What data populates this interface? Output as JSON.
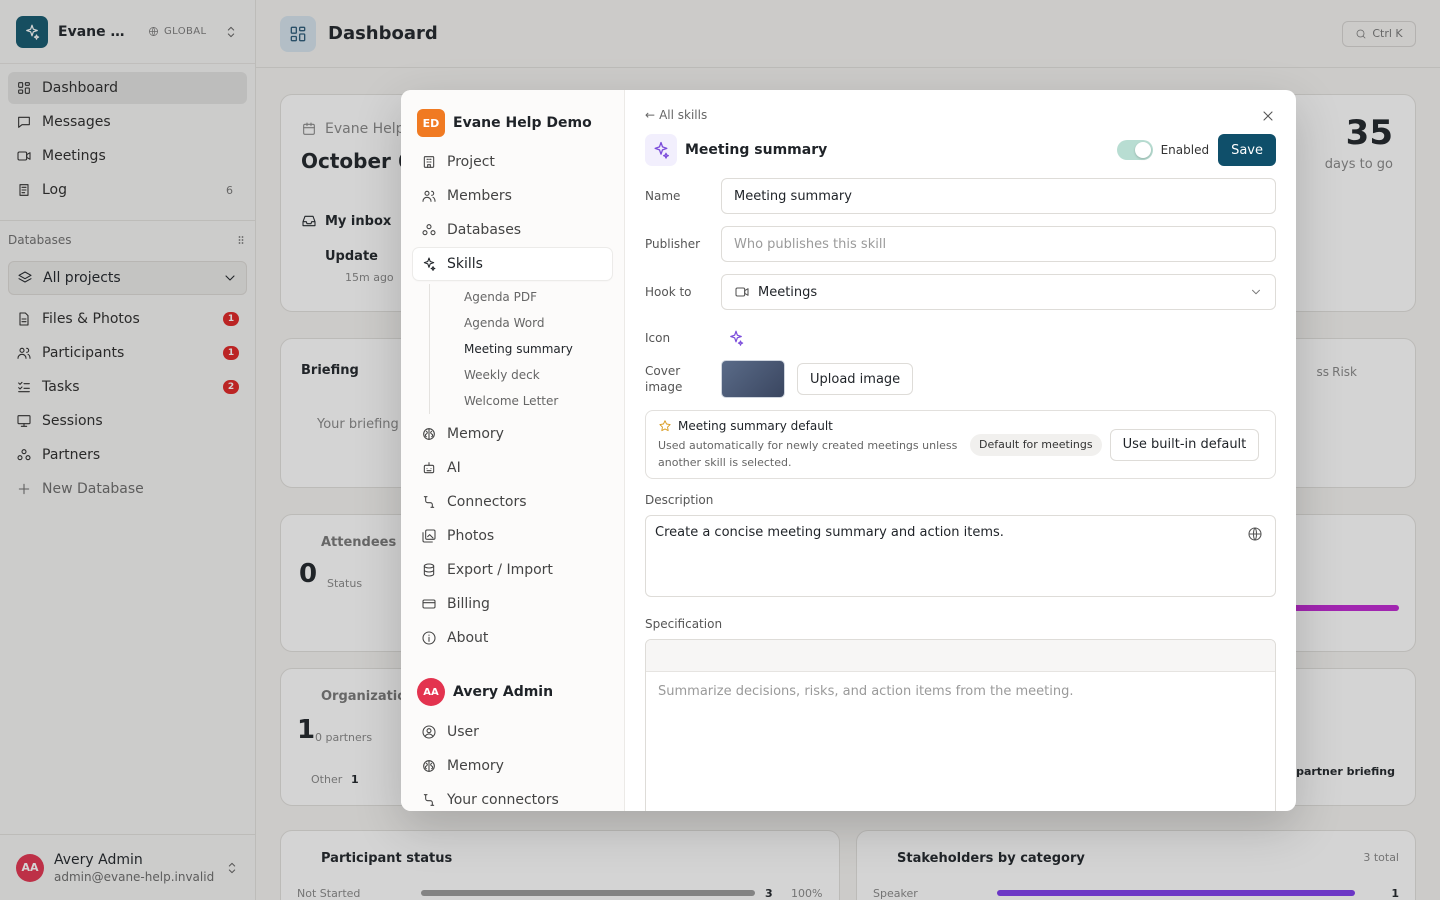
{
  "workspace": {
    "name": "Evane Help Demo",
    "scope": "GLOBAL"
  },
  "nav": [
    {
      "label": "Dashboard",
      "icon": "grid-icon",
      "active": true
    },
    {
      "label": "Messages",
      "icon": "message-icon"
    },
    {
      "label": "Meetings",
      "icon": "video-icon"
    },
    {
      "label": "Log",
      "icon": "log-icon",
      "count": "6"
    }
  ],
  "databases": {
    "title": "Databases",
    "selector": "All projects",
    "items": [
      {
        "label": "Files & Photos",
        "badge": "1"
      },
      {
        "label": "Participants",
        "badge": "1"
      },
      {
        "label": "Tasks",
        "badge": "2"
      },
      {
        "label": "Sessions"
      },
      {
        "label": "Partners"
      }
    ],
    "new_label": "New Database"
  },
  "user": {
    "name": "Avery Admin",
    "email": "admin@evane-help.invalid",
    "initials": "AA"
  },
  "dashboard": {
    "title": "Dashboard",
    "search_hint": "Ctrl K",
    "event_title": "Evane Help",
    "event_date": "October 6",
    "inbox": "My inbox",
    "update": "Update",
    "ago": "15m ago",
    "days_num": "35",
    "days_label": "days to go",
    "briefing": "Briefing",
    "briefing_body": "Your briefing",
    "briefing_tabs": [
      "ss",
      "Risk"
    ],
    "attendees": "Attendees (",
    "attendees_num": "0",
    "attendees_status": "Status",
    "organizations": "Organization",
    "org_num": "1",
    "org_partners": "0 partners",
    "org_other": "Other",
    "org_other_num": "1",
    "partner_btn": "e partner briefing",
    "participant_status": "Participant status",
    "not_started": "Not Started",
    "ns_count": "3",
    "ns_pct": "100%",
    "stakeholders": "Stakeholders by category",
    "stake_total": "3 total",
    "speaker": "Speaker",
    "speaker_count": "1"
  },
  "settings": {
    "workspace_initials": "ED",
    "workspace_name": "Evane Help Demo",
    "items": [
      {
        "label": "Project",
        "icon": "building-icon"
      },
      {
        "label": "Members",
        "icon": "users-icon"
      },
      {
        "label": "Databases",
        "icon": "databases-icon"
      },
      {
        "label": "Skills",
        "icon": "sparkles-icon",
        "active": true
      }
    ],
    "skills": [
      "Agenda PDF",
      "Agenda Word",
      "Meeting summary",
      "Weekly deck",
      "Welcome Letter"
    ],
    "active_skill": "Meeting summary",
    "items_after": [
      {
        "label": "Memory",
        "icon": "brain-icon"
      },
      {
        "label": "AI",
        "icon": "bot-icon"
      },
      {
        "label": "Connectors",
        "icon": "connector-icon"
      },
      {
        "label": "Photos",
        "icon": "photos-icon"
      },
      {
        "label": "Export / Import",
        "icon": "database-icon"
      },
      {
        "label": "Billing",
        "icon": "card-icon"
      },
      {
        "label": "About",
        "icon": "info-icon"
      }
    ],
    "user_initials": "AA",
    "user_name": "Avery Admin",
    "user_items": [
      {
        "label": "User",
        "icon": "user-circle-icon"
      },
      {
        "label": "Memory",
        "icon": "brain-icon"
      },
      {
        "label": "Your connectors",
        "icon": "connector-icon"
      }
    ]
  },
  "skill": {
    "back": "All skills",
    "title": "Meeting summary",
    "enabled_label": "Enabled",
    "save_label": "Save",
    "name_label": "Name",
    "name_value": "Meeting summary",
    "publisher_label": "Publisher",
    "publisher_placeholder": "Who publishes this skill",
    "hook_label": "Hook to",
    "hook_value": "Meetings",
    "icon_label": "Icon",
    "cover_label": "Cover image",
    "upload_label": "Upload image",
    "default_title": "Meeting summary default",
    "default_desc": "Used automatically for newly created meetings unless another skill is selected.",
    "default_chip": "Default for meetings",
    "default_btn": "Use built-in default",
    "description_label": "Description",
    "description_value": "Create a concise meeting summary and action items.",
    "spec_label": "Specification",
    "spec_placeholder": "Summarize decisions, risks, and action items from the meeting."
  },
  "colors": {
    "accent": "#0f4f6a",
    "badge": "#e02424",
    "skill_purple": "#7c4ddb",
    "ws_orange": "#f07a22",
    "avatar": "#e3334f"
  }
}
